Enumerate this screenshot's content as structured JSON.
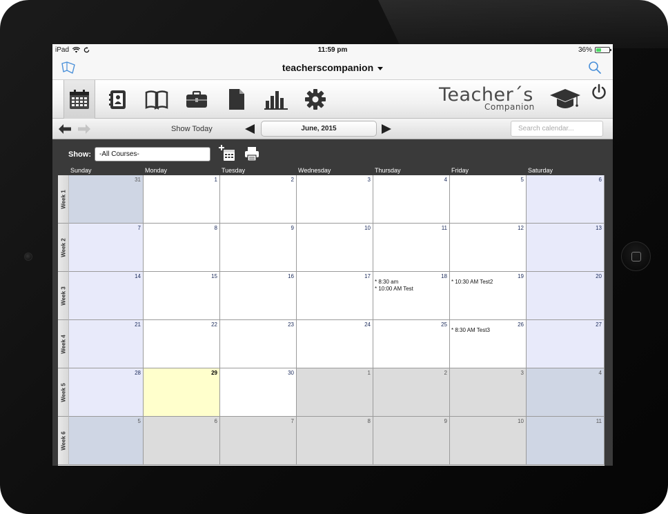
{
  "status": {
    "device": "iPad",
    "time": "11:59 pm",
    "battery": "36%",
    "battery_level": 0.36
  },
  "nav": {
    "title": "teacherscompanion"
  },
  "logo": {
    "line1": "Teacher´s",
    "line2": "Companion"
  },
  "subbar": {
    "show_today": "Show Today",
    "month": "June, 2015",
    "search_placeholder": "Search calendar..."
  },
  "filter": {
    "show_label": "Show:",
    "course": "-All Courses-"
  },
  "days": [
    "Sunday",
    "Monday",
    "Tuesday",
    "Wednesday",
    "Thursday",
    "Friday",
    "Saturday"
  ],
  "weeks": [
    {
      "label": "Week 1",
      "cells": [
        {
          "day": "31",
          "type": "other"
        },
        {
          "day": "1"
        },
        {
          "day": "2"
        },
        {
          "day": "3"
        },
        {
          "day": "4"
        },
        {
          "day": "5"
        },
        {
          "day": "6"
        }
      ]
    },
    {
      "label": "Week 2",
      "cells": [
        {
          "day": "7"
        },
        {
          "day": "8"
        },
        {
          "day": "9"
        },
        {
          "day": "10"
        },
        {
          "day": "11"
        },
        {
          "day": "12"
        },
        {
          "day": "13"
        }
      ]
    },
    {
      "label": "Week 3",
      "cells": [
        {
          "day": "14"
        },
        {
          "day": "15"
        },
        {
          "day": "16"
        },
        {
          "day": "17"
        },
        {
          "day": "18",
          "events": [
            "* 8:30 am",
            "* 10:00 AM Test"
          ]
        },
        {
          "day": "19",
          "events": [
            "* 10:30 AM Test2"
          ]
        },
        {
          "day": "20"
        }
      ]
    },
    {
      "label": "Week 4",
      "cells": [
        {
          "day": "21"
        },
        {
          "day": "22"
        },
        {
          "day": "23"
        },
        {
          "day": "24"
        },
        {
          "day": "25"
        },
        {
          "day": "26",
          "events": [
            "* 8:30 AM Test3"
          ]
        },
        {
          "day": "27"
        }
      ]
    },
    {
      "label": "Week 5",
      "cells": [
        {
          "day": "28"
        },
        {
          "day": "29",
          "today": true
        },
        {
          "day": "30"
        },
        {
          "day": "1",
          "type": "other"
        },
        {
          "day": "2",
          "type": "other"
        },
        {
          "day": "3",
          "type": "other"
        },
        {
          "day": "4",
          "type": "other"
        }
      ]
    },
    {
      "label": "Week 6",
      "cells": [
        {
          "day": "5",
          "type": "other"
        },
        {
          "day": "6",
          "type": "other"
        },
        {
          "day": "7",
          "type": "other"
        },
        {
          "day": "8",
          "type": "other"
        },
        {
          "day": "9",
          "type": "other"
        },
        {
          "day": "10",
          "type": "other"
        },
        {
          "day": "11",
          "type": "other"
        }
      ]
    }
  ],
  "colors": {
    "today": "#ffffcc",
    "weekend": "#e8eafa",
    "other_month": "#dcdcdc",
    "accent": "#4a90d9"
  }
}
